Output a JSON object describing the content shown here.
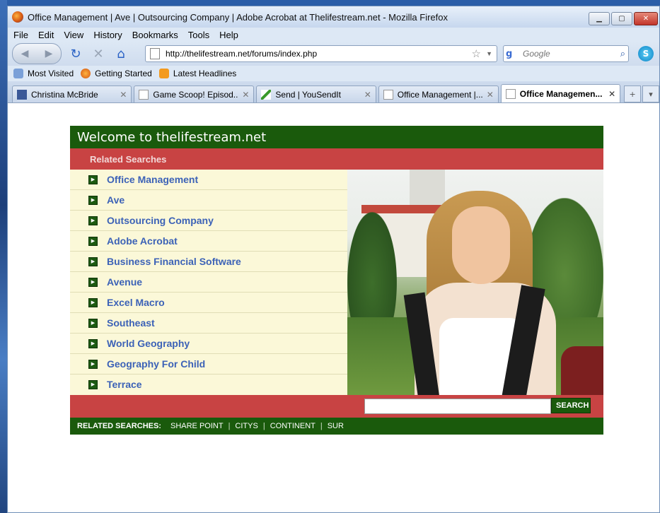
{
  "window": {
    "title": "Office Management | Ave | Outsourcing Company | Adobe Acrobat at Thelifestream.net - Mozilla Firefox"
  },
  "menu": [
    "File",
    "Edit",
    "View",
    "History",
    "Bookmarks",
    "Tools",
    "Help"
  ],
  "nav": {
    "url": "http://thelifestream.net/forums/index.php",
    "search_placeholder": "Google"
  },
  "bookmarks": [
    "Most Visited",
    "Getting Started",
    "Latest Headlines"
  ],
  "tabs": [
    {
      "label": "Christina McBride",
      "active": false
    },
    {
      "label": "Game Scoop! Episod...",
      "active": false
    },
    {
      "label": "Send | YouSendIt",
      "active": false
    },
    {
      "label": "Office Management |...",
      "active": false
    },
    {
      "label": "Office Managemen...",
      "active": true
    }
  ],
  "site": {
    "welcome": "Welcome to thelifestream.net",
    "related_heading": "Related Searches",
    "links": [
      "Office Management",
      "Ave",
      "Outsourcing Company",
      "Adobe Acrobat",
      "Business Financial Software",
      "Avenue",
      "Excel Macro",
      "Southeast",
      "World Geography",
      "Geography For Child",
      "Terrace"
    ],
    "search_button": "SEARCH",
    "footer_label": "RELATED SEARCHES:",
    "footer_terms": [
      "SHARE POINT",
      "CITYS",
      "CONTINENT",
      "SUR"
    ]
  },
  "colors": {
    "header_green": "#1a5a0c",
    "accent_red": "#c84343",
    "list_bg": "#fbf8d8",
    "link_blue": "#3c62b7"
  }
}
